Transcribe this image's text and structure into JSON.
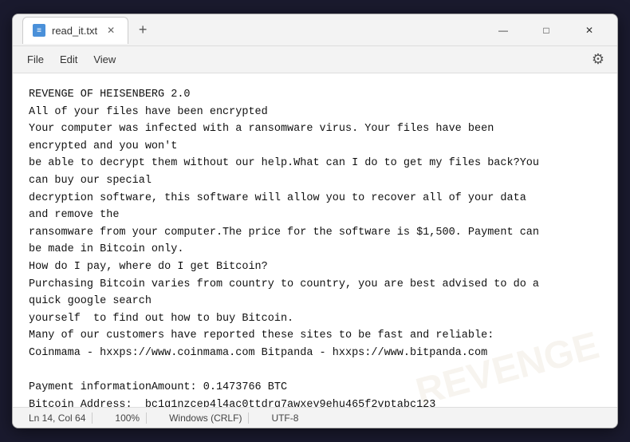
{
  "window": {
    "title": "read_it.txt",
    "new_tab_symbol": "+",
    "controls": {
      "minimize": "—",
      "maximize": "□",
      "close": "✕"
    }
  },
  "menu": {
    "items": [
      "File",
      "Edit",
      "View"
    ],
    "settings_icon": "⚙"
  },
  "editor": {
    "content": "REVENGE OF HEISENBERG 2.0\nAll of your files have been encrypted\nYour computer was infected with a ransomware virus. Your files have been\nencrypted and you won't\nbe able to decrypt them without our help.What can I do to get my files back?You\ncan buy our special\ndecryption software, this software will allow you to recover all of your data\nand remove the\nransomware from your computer.The price for the software is $1,500. Payment can\nbe made in Bitcoin only.\nHow do I pay, where do I get Bitcoin?\nPurchasing Bitcoin varies from country to country, you are best advised to do a\nquick google search\nyourself  to find out how to buy Bitcoin.\nMany of our customers have reported these sites to be fast and reliable:\nCoinmama - hxxps://www.coinmama.com Bitpanda - hxxps://www.bitpanda.com\n\nPayment informationAmount: 0.1473766 BTC\nBitcoin Address:  bc1q1nzcep4l4ac0ttdrq7awxev9ehu465f2vptabc123"
  },
  "status_bar": {
    "line": "Ln 14, Col 64",
    "zoom": "100%",
    "line_ending": "Windows (CRLF)",
    "encoding": "UTF-8"
  },
  "watermark": {
    "text": "REVENGE"
  }
}
